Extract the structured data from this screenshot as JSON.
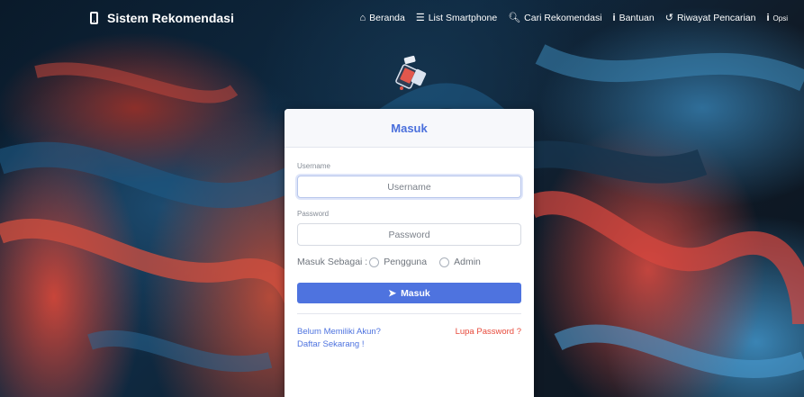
{
  "navbar": {
    "brand": "Sistem Rekomendasi",
    "brand_icon": "mobile-phone-icon",
    "items": [
      {
        "label": "Beranda",
        "icon": "home-icon"
      },
      {
        "label": "List Smartphone",
        "icon": "list-icon"
      },
      {
        "label": "Cari Rekomendasi",
        "icon": "search-icon"
      },
      {
        "label": "Bantuan",
        "icon": "info-icon"
      },
      {
        "label": "Riwayat Pencarian",
        "icon": "history-icon"
      },
      {
        "label": "Opsi",
        "icon": "info-icon"
      }
    ]
  },
  "card": {
    "title": "Masuk",
    "username": {
      "label": "Username",
      "placeholder": "Username",
      "value": ""
    },
    "password": {
      "label": "Password",
      "placeholder": "Password",
      "value": ""
    },
    "role": {
      "label": "Masuk Sebagai :",
      "options": [
        "Pengguna",
        "Admin"
      ]
    },
    "submit_label": "Masuk",
    "register_link": "Belum Memiliki Akun? Daftar Sekarang !",
    "forgot_link": "Lupa Password ?"
  },
  "colors": {
    "primary": "#4e73df",
    "danger": "#e74a3b",
    "header_text": "#4a6fdc"
  }
}
